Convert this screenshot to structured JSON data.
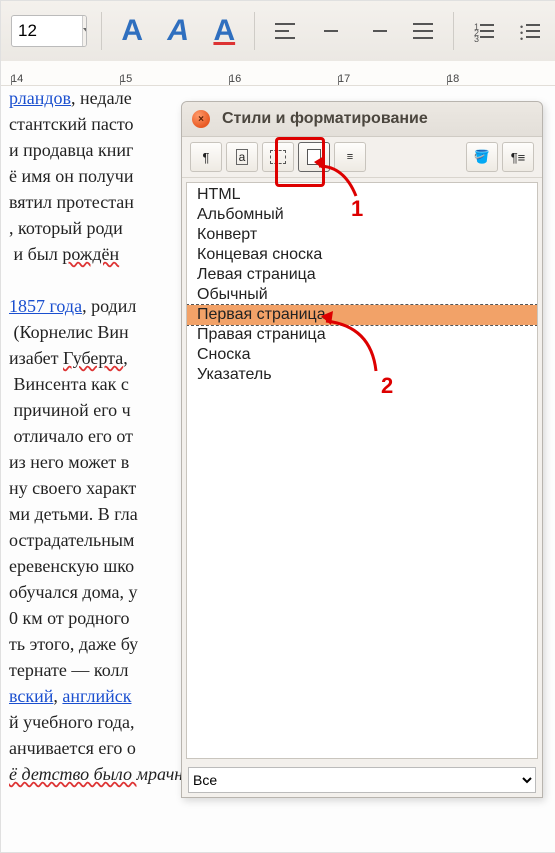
{
  "toolbar": {
    "font_size": "12",
    "bold_glyph": "A",
    "italic_glyph": "A",
    "under_glyph": "A"
  },
  "ruler": {
    "marks": [
      "14",
      "15",
      "16",
      "17",
      "18"
    ]
  },
  "document": {
    "link1": "рландов",
    "line1_rest": ", недале",
    "line2": "стантский пасто",
    "line3": "и продавца книг",
    "line4": "ё имя он получи",
    "line5": "вятил протестан",
    "line6": ", который роди",
    "line7_a": " и был ",
    "line7_spell": "рождён",
    "link2": "1857 года",
    "line8_rest": ", родил",
    "line9": " (Корнелис Вин",
    "line10_a": "изабет ",
    "line10_spell": "Губерта",
    "line10_b": ",",
    "line11": " Винсента как с",
    "line12": " причиной его ч",
    "line13": " отличало его от",
    "line14": "из него может в",
    "line15": "ну своего характ",
    "line16": "ми детьми. В гла",
    "line17": "острадательным",
    "line18": "еревенскую шко",
    "line19": "обучался дома, у",
    "line20": "0 км от родного",
    "line21": "ть этого, даже бу",
    "line22_a": "тернате — колл",
    "link3": "вский",
    "sep": ", ",
    "link4": "английск",
    "line24": "й учебного года,",
    "line25": "анчивается его о",
    "line26_a": "ё детство было ",
    "line26_b": "мрачным, холодным и"
  },
  "dialog": {
    "title": "Стили и форматирование",
    "categories": [
      "paragraph",
      "char",
      "frame",
      "page",
      "list"
    ],
    "styles": [
      "HTML",
      "Альбомный",
      "Конверт",
      "Концевая сноска",
      "Левая страница",
      "Обычный",
      "Первая страница",
      "Правая страница",
      "Сноска",
      "Указатель"
    ],
    "selected_style_index": 6,
    "filter": "Все"
  },
  "annotations": {
    "n1": "1",
    "n2": "2"
  }
}
